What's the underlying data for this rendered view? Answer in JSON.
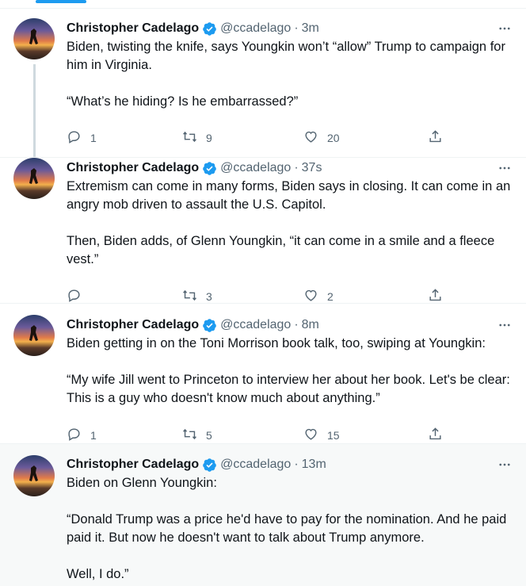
{
  "tweets": [
    {
      "name": "Christopher Cadelago",
      "handle": "@ccadelago",
      "sep": "·",
      "time": "3m",
      "paragraphs": [
        "Biden, twisting the knife, says Youngkin won’t “allow” Trump to campaign for him in Virginia.",
        "“What’s he hiding? Is he embarrassed?”"
      ],
      "replies": "1",
      "retweets": "9",
      "likes": "20"
    },
    {
      "name": "Christopher Cadelago",
      "handle": "@ccadelago",
      "sep": "·",
      "time": "37s",
      "paragraphs": [
        "Extremism can come in many forms, Biden says in closing. It can come in an angry mob driven to assault the U.S. Capitol.",
        "Then, Biden adds, of Glenn Youngkin, “it can come in a smile and a fleece vest.”"
      ],
      "replies": "",
      "retweets": "3",
      "likes": "2"
    },
    {
      "name": "Christopher Cadelago",
      "handle": "@ccadelago",
      "sep": "·",
      "time": "8m",
      "paragraphs": [
        "Biden getting in on the Toni Morrison book talk, too, swiping at Youngkin:",
        "“My wife Jill went to Princeton to interview her about her book. Let's be clear: This is a guy who doesn't know much about anything.”"
      ],
      "replies": "1",
      "retweets": "5",
      "likes": "15"
    },
    {
      "name": "Christopher Cadelago",
      "handle": "@ccadelago",
      "sep": "·",
      "time": "13m",
      "paragraphs": [
        "Biden on Glenn Youngkin:",
        "“Donald Trump was a price he'd have to pay for the nomination. And he paid paid it. But now he doesn't want to talk about Trump anymore.",
        "Well, I do.”"
      ],
      "replies": "",
      "retweets": "",
      "likes": ""
    }
  ],
  "colors": {
    "accent": "#1d9bf0",
    "muted": "#536471",
    "text": "#0f1419"
  },
  "icons": [
    "verified-badge-icon",
    "more-icon",
    "reply-icon",
    "retweet-icon",
    "like-icon",
    "share-icon"
  ]
}
